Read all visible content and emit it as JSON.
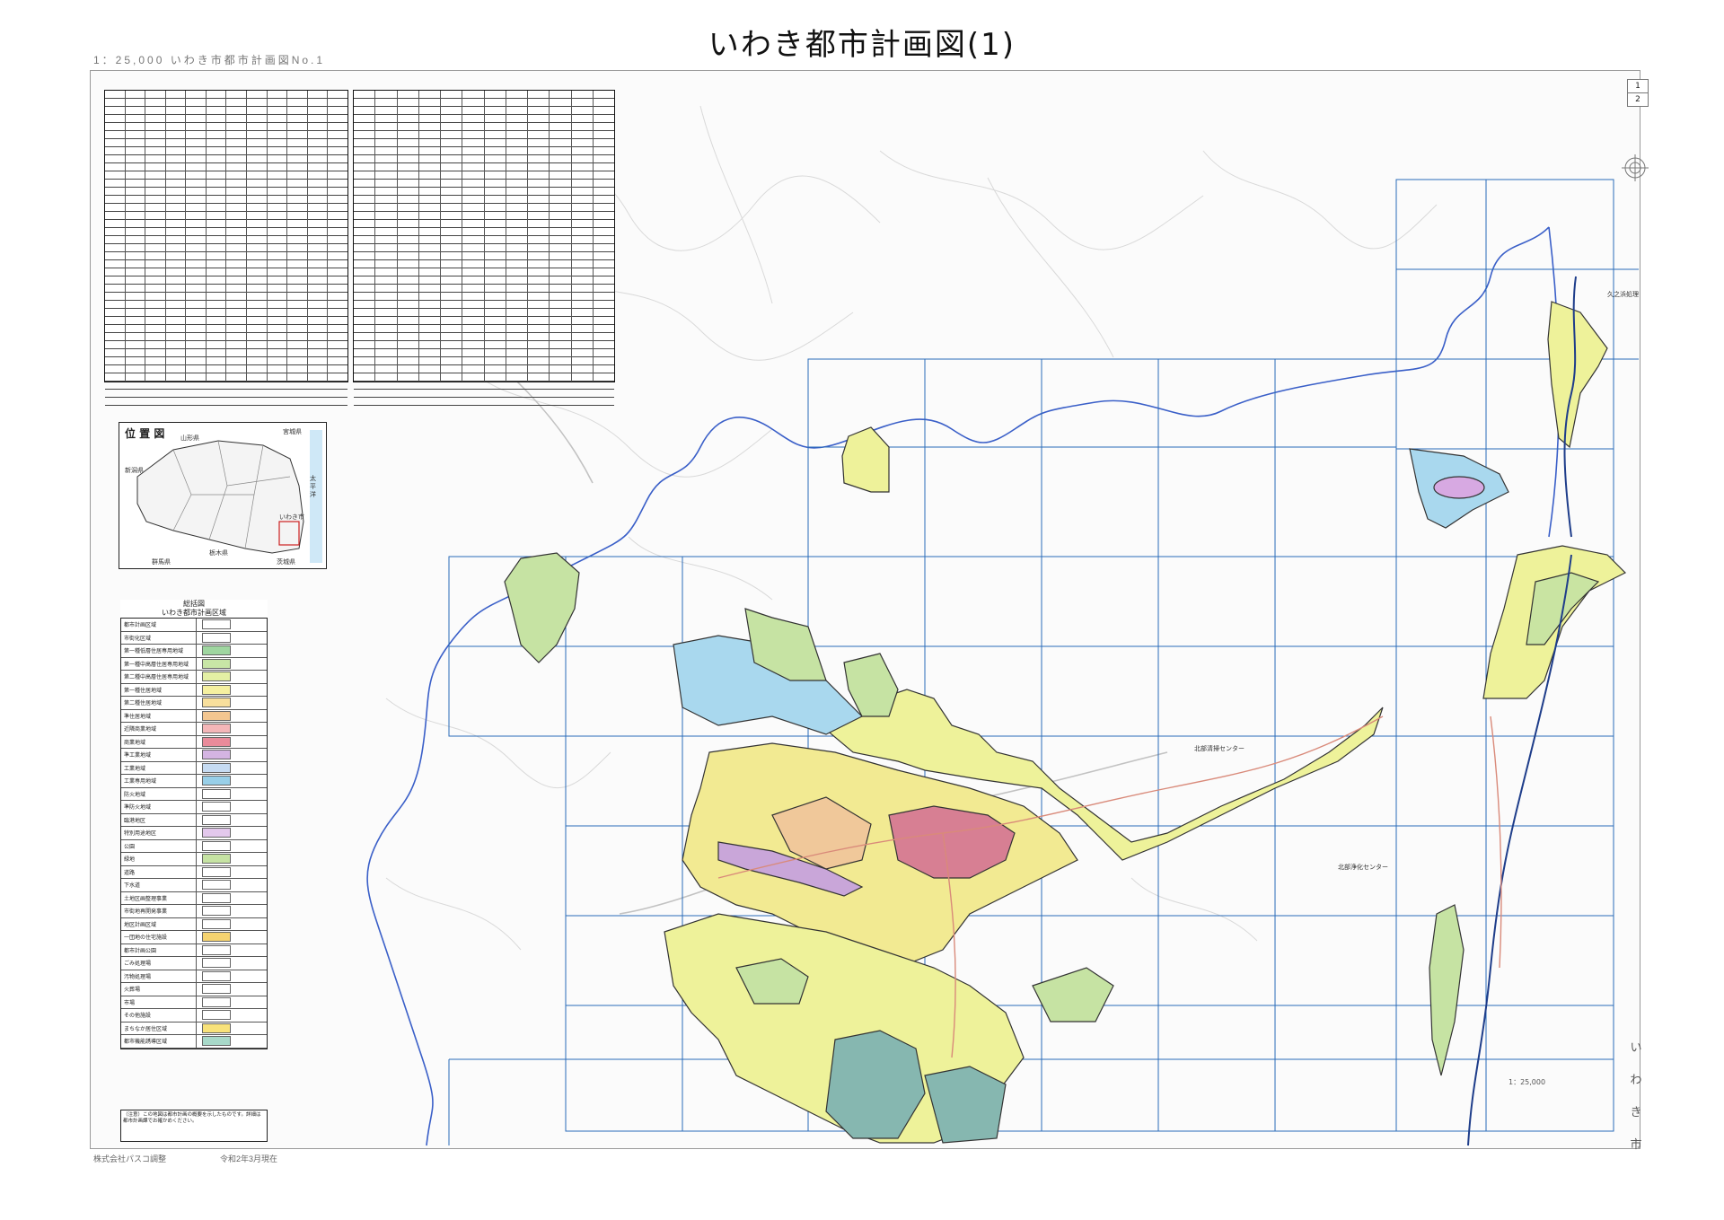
{
  "title": "いわき都市計画図(1)",
  "header_scale": "1：25,000 いわき市都市計画図No.1",
  "sheet_index": [
    "1",
    "2"
  ],
  "city_vertical": [
    "い",
    "わ",
    "き",
    "市"
  ],
  "location_map": {
    "title": "位 置 図",
    "labels": [
      "山形県",
      "宮城県",
      "新潟県",
      "太平洋",
      "栃木県",
      "茨城県",
      "群馬県",
      "いわき市"
    ]
  },
  "legend": {
    "head_line1": "総括図",
    "head_line2": "いわき都市計画区域",
    "items": [
      {
        "label": "都市計画区域",
        "color": "#ffffff"
      },
      {
        "label": "市街化区域",
        "color": "#ffffff"
      },
      {
        "label": "第一種低層住居専用地域",
        "color": "#9fd6a0"
      },
      {
        "label": "第一種中高層住居専用地域",
        "color": "#c8e6a6"
      },
      {
        "label": "第二種中高層住居専用地域",
        "color": "#e4f0a4"
      },
      {
        "label": "第一種住居地域",
        "color": "#f5f0a0"
      },
      {
        "label": "第二種住居地域",
        "color": "#f8df9c"
      },
      {
        "label": "準住居地域",
        "color": "#f3c690"
      },
      {
        "label": "近隣商業地域",
        "color": "#f4b6b8"
      },
      {
        "label": "商業地域",
        "color": "#e98b9a"
      },
      {
        "label": "準工業地域",
        "color": "#d4b4e2"
      },
      {
        "label": "工業地域",
        "color": "#c6dbf2"
      },
      {
        "label": "工業専用地域",
        "color": "#98cfe8"
      },
      {
        "label": "防火地域",
        "color": "#ffffff"
      },
      {
        "label": "準防火地域",
        "color": "#ffffff"
      },
      {
        "label": "臨港地区",
        "color": "#ffffff"
      },
      {
        "label": "特別用途地区",
        "color": "#e3c8ec"
      },
      {
        "label": "公園",
        "color": "#ffffff"
      },
      {
        "label": "緑地",
        "color": "#c6e3a3"
      },
      {
        "label": "道路",
        "color": "#ffffff"
      },
      {
        "label": "下水道",
        "color": "#ffffff"
      },
      {
        "label": "土地区画整理事業",
        "color": "#ffffff"
      },
      {
        "label": "市街地再開発事業",
        "color": "#ffffff"
      },
      {
        "label": "地区計画区域",
        "color": "#ffffff"
      },
      {
        "label": "一団地の住宅施設",
        "color": "#f5d370"
      },
      {
        "label": "都市計画公園",
        "color": "#ffffff"
      },
      {
        "label": "ごみ処理場",
        "color": "#ffffff"
      },
      {
        "label": "汚物処理場",
        "color": "#ffffff"
      },
      {
        "label": "火葬場",
        "color": "#ffffff"
      },
      {
        "label": "市場",
        "color": "#ffffff"
      },
      {
        "label": "その他施設",
        "color": "#ffffff"
      },
      {
        "label": "まちなか居住区域",
        "color": "#f8e27a"
      },
      {
        "label": "都市機能誘導区域",
        "color": "#a8d9c9"
      }
    ]
  },
  "note_text": "（注意）この地図は都市計画の概要を示したものです。詳細は都市計画課でお確かめください。",
  "footer_left": "株式会社パスコ調整",
  "footer_right": "令和2年3月現在",
  "scale_bar": "1：25,000",
  "facility_labels": [
    "久之浜処理場",
    "北部清掃センター",
    "北部浄化センター"
  ],
  "colors": {
    "grid": "#2a6bb8",
    "boundary": "#3a5fc8",
    "residential_yellow": "#eef29a",
    "industrial_blue": "#a9d8ee",
    "commercial_red": "#d77f93",
    "green": "#bfe2a0",
    "teal": "#86b7b0",
    "purple": "#c9a6d9"
  }
}
